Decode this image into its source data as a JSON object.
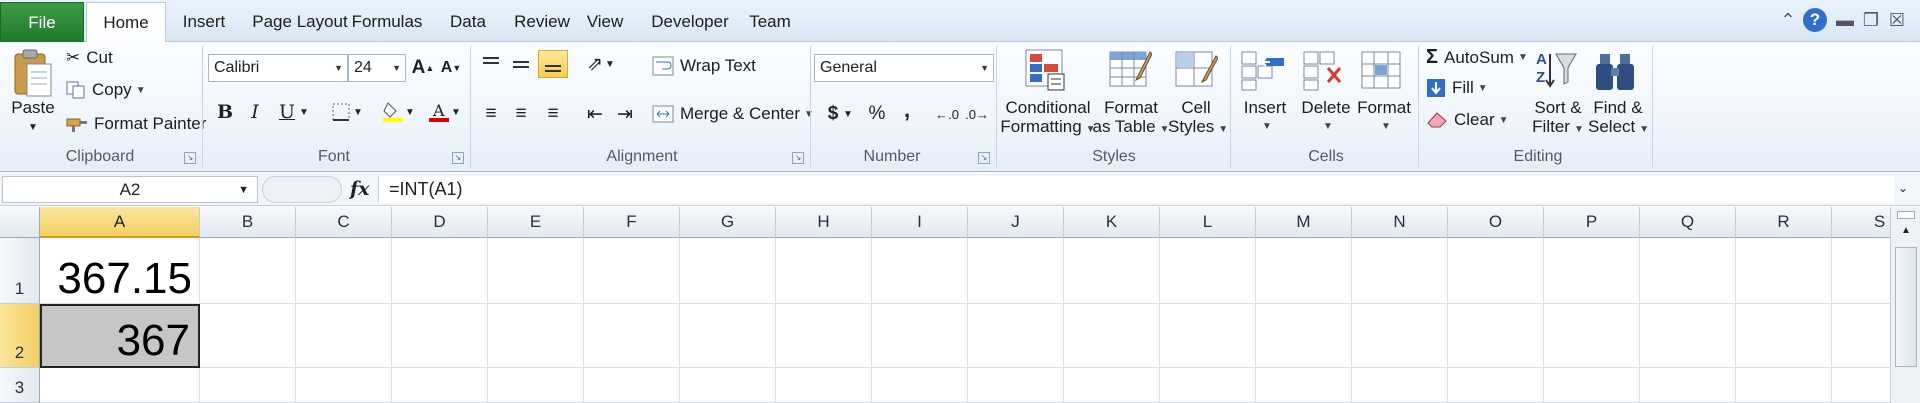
{
  "tabs": {
    "file": "File",
    "items": [
      "Home",
      "Insert",
      "Page Layout",
      "Formulas",
      "Data",
      "Review",
      "View",
      "Developer",
      "Team"
    ]
  },
  "window": {
    "help": "?"
  },
  "clipboard": {
    "paste": "Paste",
    "cut": "Cut",
    "copy": "Copy",
    "format_painter": "Format Painter",
    "label": "Clipboard"
  },
  "font": {
    "name": "Calibri",
    "size": "24",
    "bold": "B",
    "italic": "I",
    "underline": "U",
    "label": "Font"
  },
  "alignment": {
    "wrap_text": "Wrap Text",
    "merge_center": "Merge & Center",
    "label": "Alignment"
  },
  "number": {
    "format": "General",
    "currency": "$",
    "percent": "%",
    "comma": ",",
    "label": "Number"
  },
  "styles": {
    "conditional_1": "Conditional",
    "conditional_2": "Formatting",
    "format_table_1": "Format",
    "format_table_2": "as Table",
    "cell_styles_1": "Cell",
    "cell_styles_2": "Styles",
    "label": "Styles"
  },
  "cells": {
    "insert": "Insert",
    "delete": "Delete",
    "format": "Format",
    "label": "Cells"
  },
  "editing": {
    "autosum": "AutoSum",
    "fill": "Fill",
    "clear": "Clear",
    "sort_1": "Sort &",
    "sort_2": "Filter",
    "find_1": "Find &",
    "find_2": "Select",
    "label": "Editing"
  },
  "formula_bar": {
    "name_box": "A2",
    "fx": "fx",
    "formula": "=INT(A1)"
  },
  "grid": {
    "columns": [
      "A",
      "B",
      "C",
      "D",
      "E",
      "F",
      "G",
      "H",
      "I",
      "J",
      "K",
      "L",
      "M",
      "N",
      "O",
      "P",
      "Q",
      "R",
      "S"
    ],
    "rows": [
      "1",
      "2",
      "3"
    ],
    "cells": {
      "A1": "367.15",
      "A2": "367"
    },
    "selected_cell": "A2"
  }
}
